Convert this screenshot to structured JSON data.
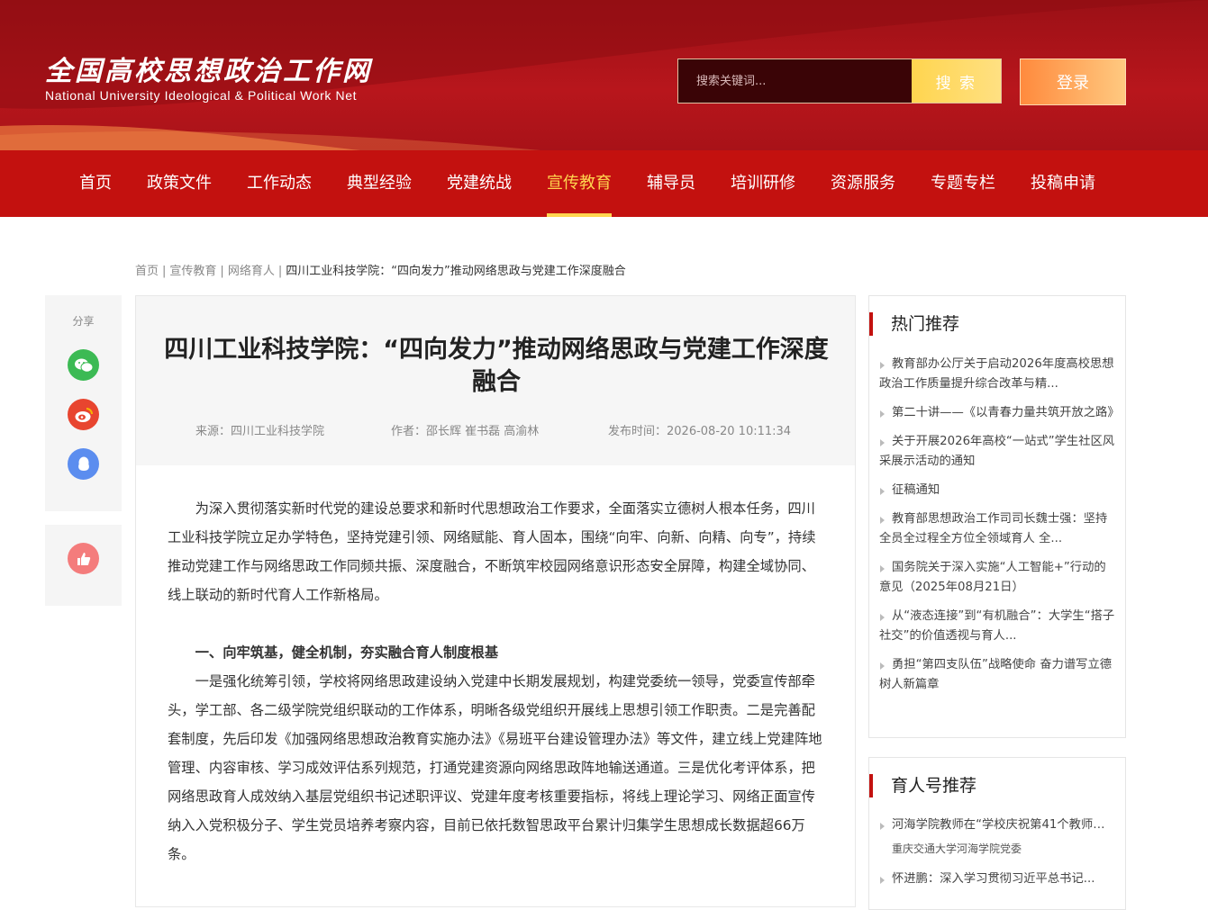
{
  "header": {
    "logo_cn": "全国高校思想政治工作网",
    "logo_en": "National University Ideological & Political Work Net",
    "search_placeholder": "搜索关键词...",
    "search_label": "搜 索",
    "login_label": "登录",
    "brand_color": "#c3110f",
    "accent_color": "#ffd54f"
  },
  "nav": {
    "items": [
      "首页",
      "政策文件",
      "工作动态",
      "典型经验",
      "党建统战",
      "宣传教育",
      "辅导员",
      "培训研修",
      "资源服务",
      "专题专栏",
      "投稿申请"
    ],
    "active": "宣传教育"
  },
  "breadcrumb": {
    "items": [
      "首页",
      "宣传教育",
      "网络育人"
    ],
    "current": "四川工业科技学院：“四向发力”推动网络思政与党建工作深度融合",
    "separator": "|"
  },
  "share": {
    "label": "分享",
    "icons": [
      "wechat-icon",
      "weibo-icon",
      "qq-icon"
    ],
    "like_icon": "thumbs-up-icon"
  },
  "article": {
    "title": "四川工业科技学院：“四向发力”推动网络思政与党建工作深度融合",
    "source": "来源：四川工业科技学院",
    "author": "作者：邵长辉 崔书磊 高渝林",
    "published": "发布时间：2026-08-20 10:11:34",
    "intro": "为深入贯彻落实新时代党的建设总要求和新时代思想政治工作要求，全面落实立德树人根本任务，四川工业科技学院立足办学特色，坚持党建引领、网络赋能、育人固本，围绕“向牢、向新、向精、向专”，持续推动党建工作与网络思政工作同频共振、深度融合，不断筑牢校园网络意识形态安全屏障，构建全域协同、线上联动的新时代育人工作新格局。",
    "section1_head": "一、向牢筑基，健全机制，夯实融合育人制度根基",
    "section1_body": "一是强化统筹引领，学校将网络思政建设纳入党建中长期发展规划，构建党委统一领导，党委宣传部牵头，学工部、各二级学院党组织联动的工作体系，明晰各级党组织开展线上思想引领工作职责。二是完善配套制度，先后印发《加强网络思想政治教育实施办法》《易班平台建设管理办法》等文件，建立线上党建阵地管理、内容审核、学习成效评估系列规范，打通党建资源向网络思政阵地输送通道。三是优化考评体系，把网络思政育人成效纳入基层党组织书记述职评议、党建年度考核重要指标，将线上理论学习、网络正面宣传纳入入党积极分子、学生党员培养考察内容，目前已依托数智思政平台累计归集学生思想成长数据超66万条。"
  },
  "hot": {
    "title": "热门推荐",
    "items": [
      "教育部办公厅关于启动2026年度高校思想政治工作质量提升综合改革与精...",
      "第二十讲——《以青春力量共筑开放之路》",
      "关于开展2026年高校“一站式”学生社区风采展示活动的通知",
      "征稿通知",
      "教育部思想政治工作司司长魏士强：坚持全员全过程全方位全领域育人 全...",
      "国务院关于深入实施“人工智能+”行动的意见（2025年08月21日）",
      "从“液态连接”到“有机融合”：大学生“搭子社交”的价值透视与育人...",
      "勇担“第四支队伍”战略使命 奋力谱写立德树人新篇章"
    ]
  },
  "yuren": {
    "title": "育人号推荐",
    "items": [
      {
        "title": "河海学院教师在“学校庆祝第41个教师节...",
        "sub": "重庆交通大学河海学院党委"
      },
      {
        "title": "怀进鹏：深入学习贯彻习近平总书记...",
        "sub": ""
      }
    ]
  }
}
